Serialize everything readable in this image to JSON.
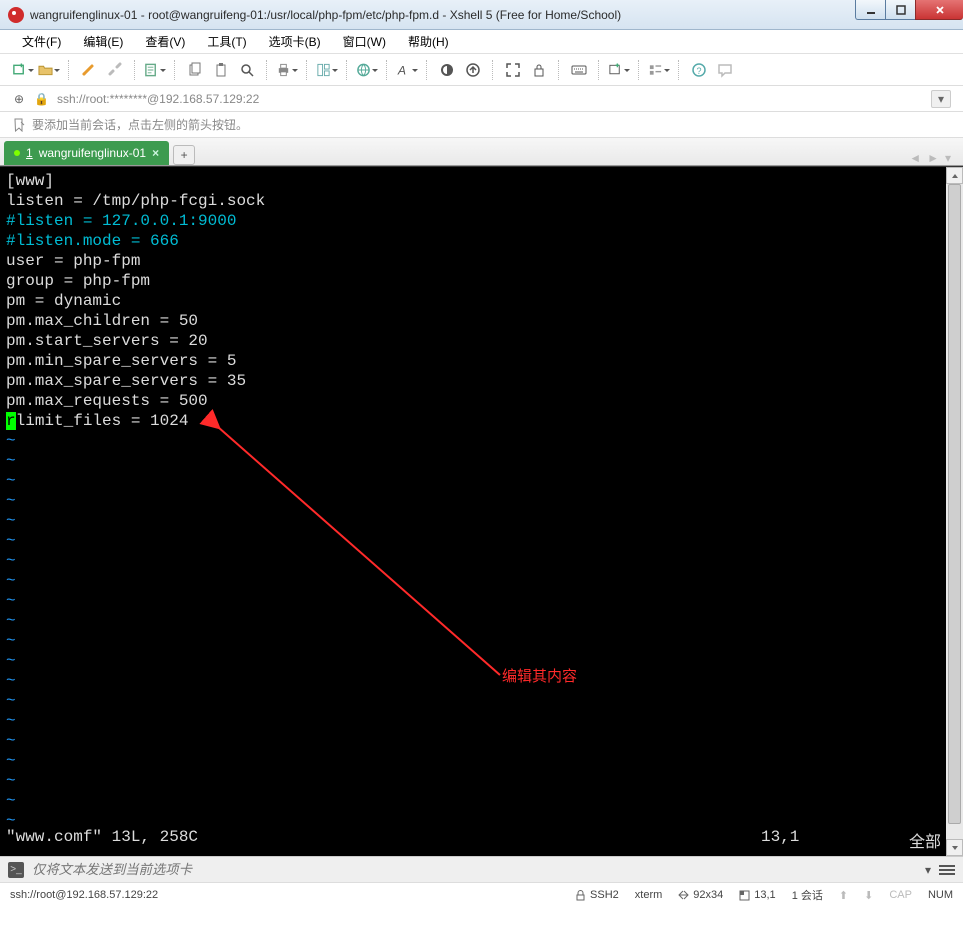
{
  "window": {
    "title": "wangruifenglinux-01 - root@wangruifeng-01:/usr/local/php-fpm/etc/php-fpm.d - Xshell 5 (Free for Home/School)"
  },
  "menu": {
    "file": "文件(F)",
    "edit": "编辑(E)",
    "view": "查看(V)",
    "tools": "工具(T)",
    "tab": "选项卡(B)",
    "window": "窗口(W)",
    "help": "帮助(H)"
  },
  "addressbar": {
    "url": "ssh://root:********@192.168.57.129:22"
  },
  "infobar": {
    "text": "要添加当前会话，点击左侧的箭头按钮。"
  },
  "tab": {
    "index": "1",
    "label": "wangruifenglinux-01"
  },
  "terminal": {
    "lines": [
      {
        "t": "[www]",
        "cls": ""
      },
      {
        "t": "listen = /tmp/php-fcgi.sock",
        "cls": ""
      },
      {
        "t": "#listen = 127.0.0.1:9000",
        "cls": "c-cyan"
      },
      {
        "t": "#listen.mode = 666",
        "cls": "c-cyan"
      },
      {
        "t": "user = php-fpm",
        "cls": ""
      },
      {
        "t": "group = php-fpm",
        "cls": ""
      },
      {
        "t": "pm = dynamic",
        "cls": ""
      },
      {
        "t": "pm.max_children = 50",
        "cls": ""
      },
      {
        "t": "pm.start_servers = 20",
        "cls": ""
      },
      {
        "t": "pm.min_spare_servers = 5",
        "cls": ""
      },
      {
        "t": "pm.max_spare_servers = 35",
        "cls": ""
      },
      {
        "t": "pm.max_requests = 500",
        "cls": ""
      }
    ],
    "cursor_line_prefix": "r",
    "cursor_line_rest": "limit_files = 1024",
    "status_left": "\"www.comf\" 13L, 258C",
    "status_pos": "13,1",
    "status_right": "全部"
  },
  "annotation": {
    "label": "编辑其内容"
  },
  "inputbar": {
    "placeholder": "仅将文本发送到当前选项卡"
  },
  "statusbar": {
    "conn": "ssh://root@192.168.57.129:22",
    "ssh": "SSH2",
    "term": "xterm",
    "size": "92x34",
    "pos": "13,1",
    "sessions": "1 会话",
    "cap": "CAP",
    "num": "NUM"
  }
}
